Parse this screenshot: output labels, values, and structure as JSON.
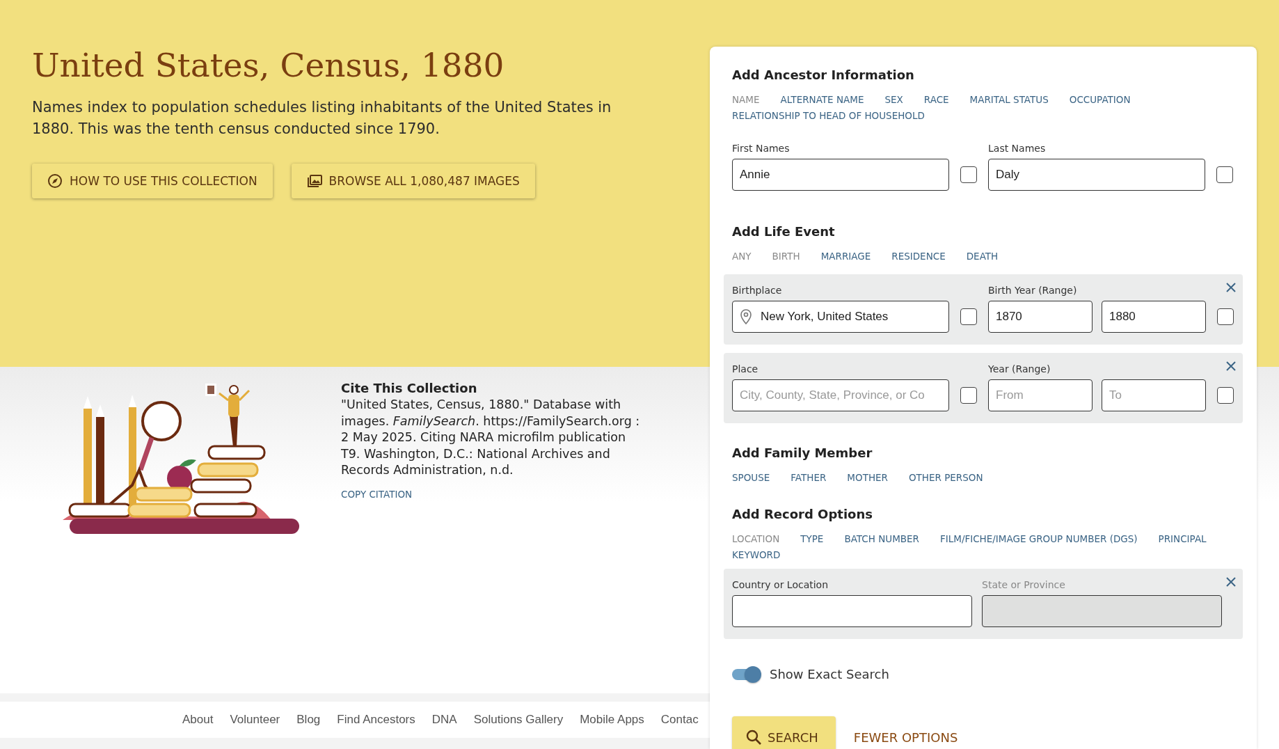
{
  "hero": {
    "title": "United States, Census, 1880",
    "description": "Names index to population schedules listing inhabitants of the United States in 1880. This was the tenth census conducted since 1790.",
    "buttons": [
      {
        "kind": "guide",
        "label": "HOW TO USE THIS COLLECTION"
      },
      {
        "kind": "images",
        "label": "BROWSE ALL 1,080,487 IMAGES"
      }
    ]
  },
  "citation": {
    "heading": "Cite This Collection",
    "text": "\"United States, Census, 1880.\" Database with images. *FamilySearch*. https://FamilySearch.org : 2 May 2025. Citing NARA microfilm publication T9. Washington, D.C.: National Archives and Records Administration, n.d.",
    "link": "COPY CITATION"
  },
  "footer": {
    "links": [
      "About",
      "Volunteer",
      "Blog",
      "Find Ancestors",
      "DNA",
      "Solutions Gallery",
      "Mobile Apps",
      "Contac"
    ]
  },
  "search_panel": {
    "ancestor": {
      "heading": "Add Ancestor Information",
      "options": [
        {
          "label": "NAME",
          "disabled": true
        },
        {
          "label": "ALTERNATE NAME",
          "disabled": false
        },
        {
          "label": "SEX",
          "disabled": false
        },
        {
          "label": "RACE",
          "disabled": false
        },
        {
          "label": "MARITAL STATUS",
          "disabled": false
        },
        {
          "label": "OCCUPATION",
          "disabled": false
        },
        {
          "label": "RELATIONSHIP TO HEAD OF HOUSEHOLD",
          "disabled": false
        }
      ],
      "fields": [
        {
          "label": "First Names",
          "value": "Annie",
          "checked": false
        },
        {
          "label": "Last Names",
          "value": "Daly",
          "checked": false
        }
      ]
    },
    "life_event": {
      "heading": "Add Life Event",
      "options": [
        {
          "label": "ANY",
          "disabled": true
        },
        {
          "label": "BIRTH",
          "disabled": true
        },
        {
          "label": "MARRIAGE",
          "disabled": false
        },
        {
          "label": "RESIDENCE",
          "disabled": false
        },
        {
          "label": "DEATH",
          "disabled": false
        }
      ],
      "events": [
        {
          "place_label": "Birthplace",
          "place_value": "New York, United States",
          "place_checked": false,
          "year_label": "Birth Year (Range)",
          "from_value": "1870",
          "to_value": "1880",
          "year_checked": false
        },
        {
          "place_label": "Place",
          "place_placeholder": "City, County, State, Province, or Co",
          "place_checked": false,
          "year_label": "Year (Range)",
          "from_placeholder": "From",
          "to_placeholder": "To",
          "year_checked": false
        }
      ]
    },
    "family": {
      "heading": "Add Family Member",
      "options": [
        {
          "label": "SPOUSE",
          "disabled": false
        },
        {
          "label": "FATHER",
          "disabled": false
        },
        {
          "label": "MOTHER",
          "disabled": false
        },
        {
          "label": "OTHER PERSON",
          "disabled": false
        }
      ]
    },
    "record": {
      "heading": "Add Record Options",
      "options": [
        {
          "label": "LOCATION",
          "disabled": true
        },
        {
          "label": "TYPE",
          "disabled": false
        },
        {
          "label": "BATCH NUMBER",
          "disabled": false
        },
        {
          "label": "FILM/FICHE/IMAGE GROUP NUMBER (DGS)",
          "disabled": false
        },
        {
          "label": "PRINCIPAL",
          "disabled": false
        },
        {
          "label": "KEYWORD",
          "disabled": false
        }
      ],
      "location": [
        {
          "label": "Country or Location",
          "disabled": false
        },
        {
          "label": "State or Province",
          "disabled": true
        }
      ]
    },
    "exact_search": {
      "label": "Show Exact Search",
      "on": true
    },
    "search_button": "SEARCH",
    "fewer_options": "FEWER OPTIONS"
  }
}
